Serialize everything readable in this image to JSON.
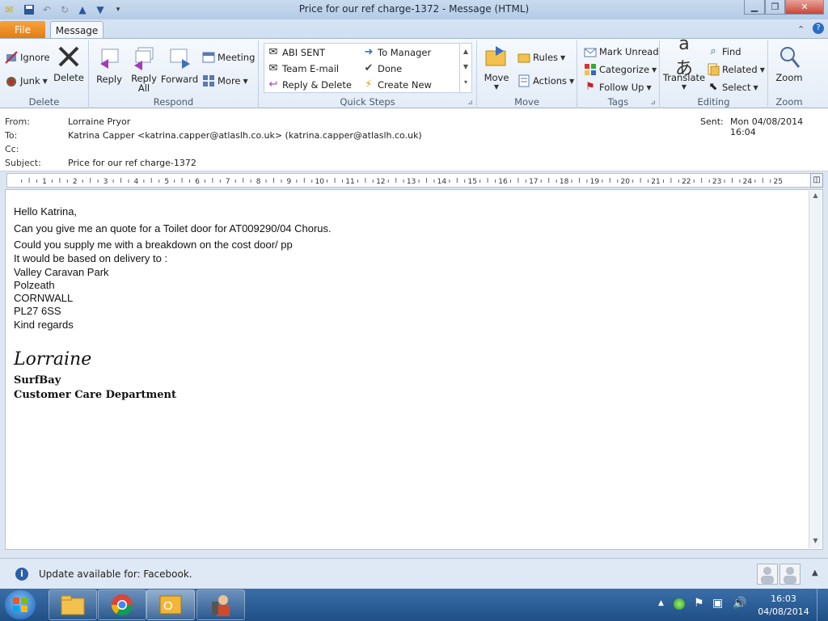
{
  "window": {
    "title": "Price for our ref charge-1372  -  Message (HTML)"
  },
  "ribbon": {
    "tabs": {
      "file": "File",
      "message": "Message"
    },
    "groups": {
      "delete": {
        "label": "Delete",
        "ignore": "Ignore",
        "junk": "Junk",
        "delete": "Delete"
      },
      "respond": {
        "label": "Respond",
        "reply": "Reply",
        "reply_all_1": "Reply",
        "reply_all_2": "All",
        "forward": "Forward",
        "meeting": "Meeting",
        "more": "More"
      },
      "quick_steps": {
        "label": "Quick Steps",
        "items": [
          "ABI SENT",
          "To Manager",
          "Team E-mail",
          "Done",
          "Reply & Delete",
          "Create New"
        ]
      },
      "move": {
        "label": "Move",
        "move": "Move",
        "rules": "Rules",
        "actions": "Actions"
      },
      "tags": {
        "label": "Tags",
        "mark_unread": "Mark Unread",
        "categorize": "Categorize",
        "follow_up": "Follow Up"
      },
      "editing": {
        "label": "Editing",
        "translate": "Translate",
        "find": "Find",
        "related": "Related",
        "select": "Select"
      },
      "zoom": {
        "label": "Zoom",
        "zoom": "Zoom"
      }
    }
  },
  "header": {
    "from_label": "From:",
    "from": "Lorraine Pryor",
    "to_label": "To:",
    "to": "Katrina Capper <katrina.capper@atlaslh.co.uk> (katrina.capper@atlaslh.co.uk)",
    "cc_label": "Cc:",
    "subject_label": "Subject:",
    "subject": "Price for our ref charge-1372",
    "sent_label": "Sent:",
    "sent": "Mon 04/08/2014 16:04"
  },
  "ruler": {
    "ticks": [
      "1",
      "2",
      "3",
      "4",
      "5",
      "6",
      "7",
      "8",
      "9",
      "10",
      "11",
      "12",
      "13",
      "14",
      "15",
      "16",
      "17",
      "18",
      "19",
      "20",
      "21",
      "22",
      "23",
      "24",
      "25"
    ]
  },
  "body": {
    "lines": [
      "Hello Katrina,",
      "Can you give me an quote for a Toilet door for AT009290/04 Chorus.",
      "Could you supply me with a breakdown on the cost door/ pp",
      "It would be based on delivery to :",
      "Valley Caravan Park",
      "Polzeath",
      "CORNWALL",
      "PL27 6SS",
      "Kind regards"
    ],
    "signature_name": "Lorraine",
    "signature_company": "SurfBay",
    "signature_dept": "Customer Care Department"
  },
  "infobar": {
    "text": "Update available for: Facebook."
  },
  "taskbar": {
    "time": "16:03",
    "date": "04/08/2014"
  },
  "colors": {
    "file_tab": "#e27a12",
    "taskbar": "#1f4f86",
    "ribbon_border": "#9fb3cc"
  }
}
